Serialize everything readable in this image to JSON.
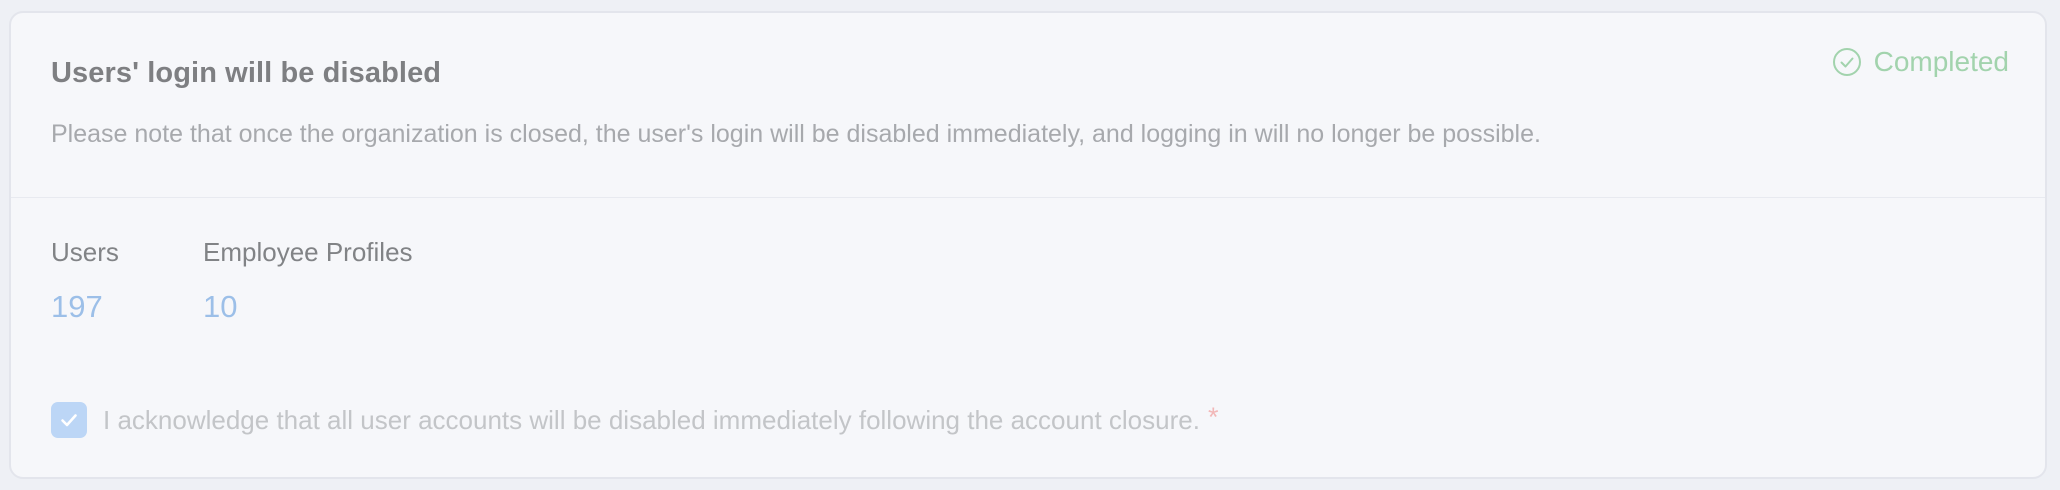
{
  "card": {
    "title": "Users' login will be disabled",
    "description": "Please note that once the organization is closed, the user's login will be disabled immediately, and logging in will no longer be possible.",
    "status": {
      "label": "Completed",
      "icon": "check-circle-icon",
      "color": "#a2d3ad"
    }
  },
  "stats": [
    {
      "label": "Users",
      "value": "197"
    },
    {
      "label": "Employee Profiles",
      "value": "10"
    }
  ],
  "acknowledgement": {
    "checked": true,
    "label": "I acknowledge that all user accounts will be disabled immediately following the account closure.",
    "required_marker": "*"
  },
  "colors": {
    "accent_value": "#9cbfe8",
    "checkbox": "#bcd6f6",
    "required": "#f2b8b8"
  }
}
